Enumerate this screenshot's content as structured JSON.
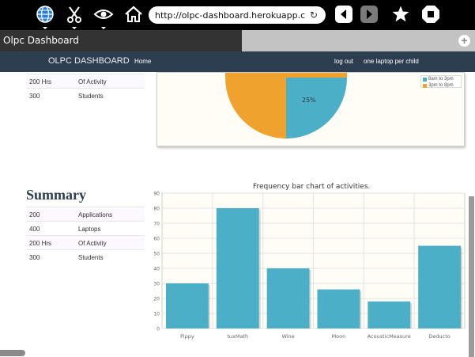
{
  "browser": {
    "url": "http://olpc-dashboard.herokuapp.com",
    "tab_title": "Olpc Dashboard",
    "tab_add_glyph": "+"
  },
  "toolbar_icons": [
    "globe-icon",
    "scissors-icon",
    "eye-icon",
    "home-icon",
    "back-icon",
    "forward-icon",
    "star-icon",
    "stop-icon"
  ],
  "navbar": {
    "brand": "OLPC DASHBOARD",
    "home": "Home",
    "logout": "log out",
    "olpc_link": "one laptop per child"
  },
  "top_stats": [
    {
      "value": "200 Hrs",
      "label": "Of Activity"
    },
    {
      "value": "300",
      "label": "Students"
    }
  ],
  "summary": {
    "title": "Summary",
    "rows": [
      {
        "value": "200",
        "label": "Applications"
      },
      {
        "value": "400",
        "label": "Laptops"
      },
      {
        "value": "200 Hrs",
        "label": "Of Activity"
      },
      {
        "value": "300",
        "label": "Students"
      }
    ]
  },
  "pie": {
    "visible_label": "25%",
    "legend": [
      {
        "label": "8am to 3pm",
        "color": "#4bafc8"
      },
      {
        "label": "3pm to 8pm",
        "color": "#f0a22e"
      }
    ]
  },
  "colors": {
    "navbar": "#2c3e50",
    "bar": "#4bafc8",
    "pie_orange": "#f0a22e",
    "pie_blue": "#4bafc8"
  },
  "chart_data": {
    "type": "bar",
    "title": "Frequency bar chart of activities.",
    "categories": [
      "Pippy",
      "tuxMath",
      "Wine",
      "Moon",
      "AcousticMeasure",
      "Deducto"
    ],
    "values": [
      30,
      80,
      40,
      26,
      18,
      55
    ],
    "ylim": [
      0,
      90
    ],
    "yticks": [
      0,
      10,
      20,
      30,
      40,
      50,
      60,
      70,
      80,
      90
    ],
    "grid": true,
    "xlabel": "",
    "ylabel": ""
  }
}
